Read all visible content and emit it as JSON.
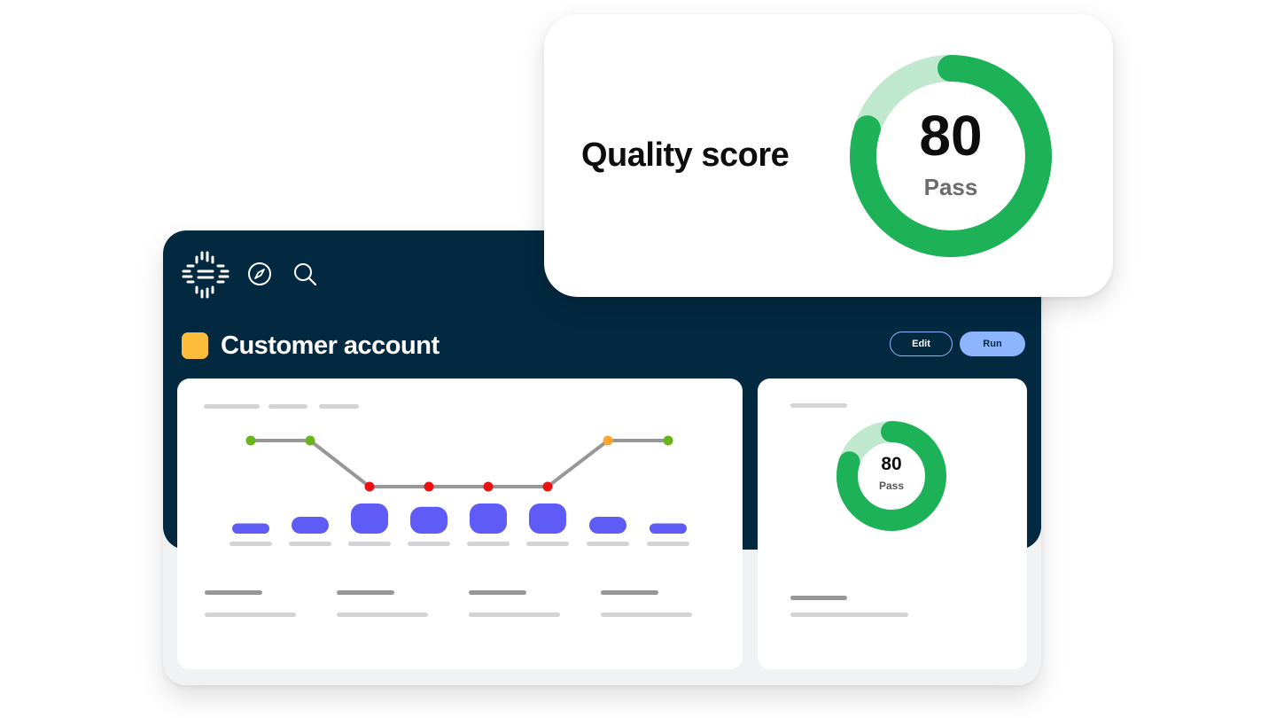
{
  "app": {
    "title": "Customer account",
    "record_icon_color": "#fdbd3a",
    "header_color": "#032940",
    "buttons": {
      "edit_label": "Edit",
      "run_label": "Run"
    },
    "icons": [
      "platform-logo-icon",
      "compass-icon",
      "search-icon"
    ]
  },
  "quality_popup": {
    "title": "Quality score",
    "score": "80",
    "status": "Pass",
    "score_value": 80,
    "colors": {
      "fill": "#1db257",
      "track": "#bfe8cf"
    }
  },
  "summary_card": {
    "score": "80",
    "status": "Pass",
    "score_value": 80
  },
  "chart_data": {
    "type": "line",
    "series": [
      {
        "point_status": [
          "good",
          "good",
          "bad",
          "bad",
          "bad",
          "bad",
          "warn",
          "good"
        ],
        "values": [
          2,
          2,
          1,
          1,
          1,
          1,
          2,
          2
        ],
        "bar_values": [
          1,
          2,
          4,
          3.5,
          4,
          4,
          2,
          1
        ]
      }
    ],
    "status_colors": {
      "good": "#67b51a",
      "warn": "#fda62b",
      "bad": "#ee1111"
    },
    "line_color": "#979797",
    "bar_color": "#5f5bf6",
    "ylim": [
      0,
      2.5
    ],
    "grid": false
  }
}
